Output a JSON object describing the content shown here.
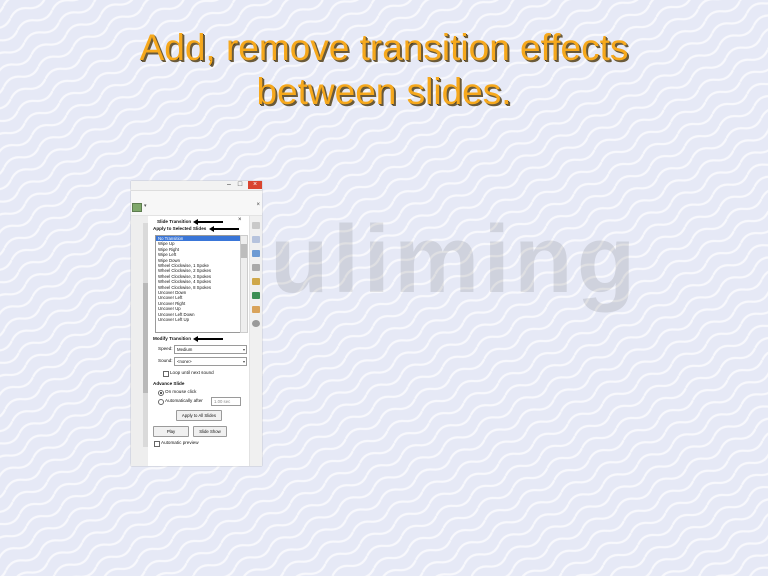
{
  "slide": {
    "title_line1": "Add, remove transition effects",
    "title_line2": "between slides."
  },
  "window": {
    "minimize": "–",
    "maximize": "□",
    "close": "×",
    "toolbar_dropdown": "▾",
    "toolbar_close": "×"
  },
  "panel": {
    "title": "Slide Transition",
    "close": "×",
    "apply_heading": "Apply to Selected Slides",
    "transitions": [
      "No Transition",
      "Wipe Up",
      "Wipe Right",
      "Wipe Left",
      "Wipe Down",
      "Wheel Clockwise, 1 Spoke",
      "Wheel Clockwise, 2 Spokes",
      "Wheel Clockwise, 3 Spokes",
      "Wheel Clockwise, 4 Spokes",
      "Wheel Clockwise, 8 Spokes",
      "Uncover Down",
      "Uncover Left",
      "Uncover Right",
      "Uncover Up",
      "Uncover Left Down",
      "Uncover Left Up"
    ],
    "selected_transition_index": 0,
    "modify_heading": "Modify Transition",
    "speed_label": "Speed:",
    "speed_value": "Medium",
    "sound_label": "Sound:",
    "sound_value": "<none>",
    "loop_label": "Loop until next sound",
    "advance_heading": "Advance Slide",
    "on_mouse_click": "On mouse click",
    "automatically_after": "Automatically after",
    "auto_value": "1.00 sec",
    "apply_all_button": "Apply to All Slides",
    "play_button": "Play",
    "slideshow_button": "Slide Show",
    "automatic_preview": "Automatic preview"
  },
  "colors": {
    "title": "#f6a81c",
    "selection": "#3a76d8",
    "close_button": "#d9442f"
  }
}
